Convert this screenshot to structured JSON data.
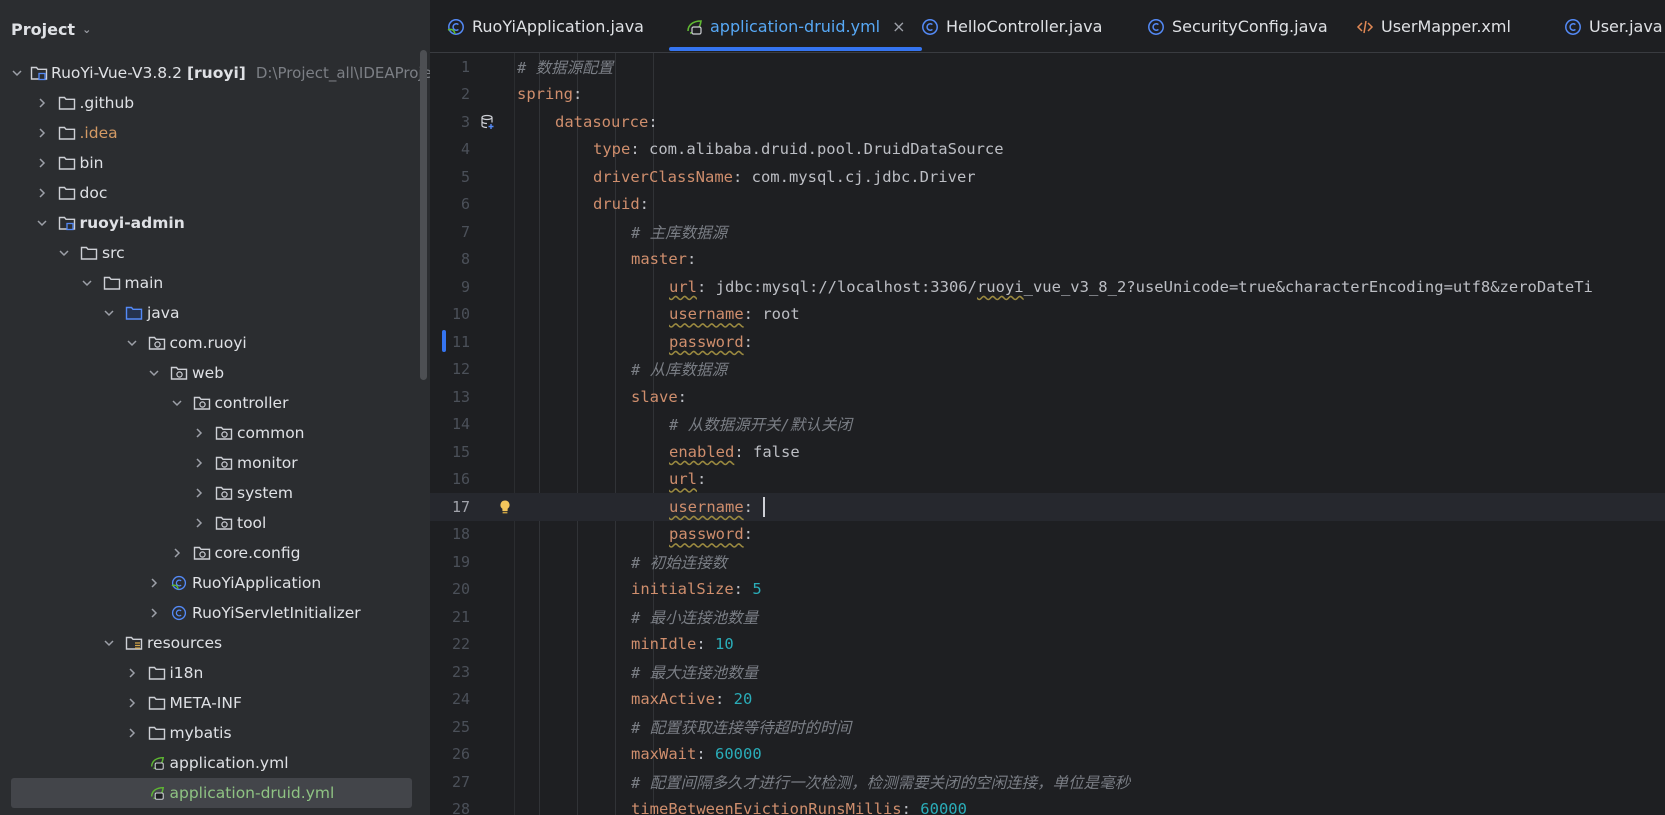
{
  "project_panel": {
    "title": "Project",
    "tree": [
      {
        "label": "RuoYi-Vue-V3.8.2",
        "suffix": "[ruoyi]",
        "path": "D:\\Project_all\\IDEAProjec",
        "depth": 0,
        "expanded": true,
        "icon": "module-folder-icon"
      },
      {
        "label": ".github",
        "depth": 1,
        "expanded": false,
        "icon": "folder-icon"
      },
      {
        "label": ".idea",
        "depth": 1,
        "expanded": false,
        "icon": "folder-icon",
        "style": "orange"
      },
      {
        "label": "bin",
        "depth": 1,
        "expanded": false,
        "icon": "folder-icon"
      },
      {
        "label": "doc",
        "depth": 1,
        "expanded": false,
        "icon": "folder-icon"
      },
      {
        "label": "ruoyi-admin",
        "depth": 1,
        "expanded": true,
        "icon": "module-folder-icon",
        "style": "bold"
      },
      {
        "label": "src",
        "depth": 2,
        "expanded": true,
        "icon": "folder-icon"
      },
      {
        "label": "main",
        "depth": 3,
        "expanded": true,
        "icon": "folder-icon"
      },
      {
        "label": "java",
        "depth": 4,
        "expanded": true,
        "icon": "source-folder-icon"
      },
      {
        "label": "com.ruoyi",
        "depth": 5,
        "expanded": true,
        "icon": "package-icon"
      },
      {
        "label": "web",
        "depth": 6,
        "expanded": true,
        "icon": "package-icon"
      },
      {
        "label": "controller",
        "depth": 7,
        "expanded": true,
        "icon": "package-icon"
      },
      {
        "label": "common",
        "depth": 8,
        "expanded": false,
        "icon": "package-icon"
      },
      {
        "label": "monitor",
        "depth": 8,
        "expanded": false,
        "icon": "package-icon"
      },
      {
        "label": "system",
        "depth": 8,
        "expanded": false,
        "icon": "package-icon"
      },
      {
        "label": "tool",
        "depth": 8,
        "expanded": false,
        "icon": "package-icon"
      },
      {
        "label": "core.config",
        "depth": 7,
        "expanded": false,
        "icon": "package-icon"
      },
      {
        "label": "RuoYiApplication",
        "depth": 6,
        "expanded": false,
        "icon": "spring-class-icon"
      },
      {
        "label": "RuoYiServletInitializer",
        "depth": 6,
        "expanded": false,
        "icon": "class-icon"
      },
      {
        "label": "resources",
        "depth": 4,
        "expanded": true,
        "icon": "resources-folder-icon"
      },
      {
        "label": "i18n",
        "depth": 5,
        "expanded": false,
        "icon": "folder-icon"
      },
      {
        "label": "META-INF",
        "depth": 5,
        "expanded": false,
        "icon": "folder-icon"
      },
      {
        "label": "mybatis",
        "depth": 5,
        "expanded": false,
        "icon": "folder-icon"
      },
      {
        "label": "application.yml",
        "depth": 5,
        "leaf": true,
        "icon": "spring-yaml-icon"
      },
      {
        "label": "application-druid.yml",
        "depth": 5,
        "leaf": true,
        "icon": "spring-yaml-icon",
        "selected": true,
        "style": "green"
      }
    ]
  },
  "tabs": [
    {
      "label": "RuoYiApplication.java",
      "icon": "spring-class-icon",
      "active": false
    },
    {
      "label": "application-druid.yml",
      "icon": "spring-yaml-icon",
      "active": true,
      "close": "×"
    },
    {
      "label": "HelloController.java",
      "icon": "class-icon",
      "active": false
    },
    {
      "label": "SecurityConfig.java",
      "icon": "class-icon",
      "active": false
    },
    {
      "label": "UserMapper.xml",
      "icon": "xml-icon",
      "active": false
    },
    {
      "label": "User.java",
      "icon": "class-icon",
      "active": false
    }
  ],
  "editor": {
    "current_line": 17,
    "lines": [
      {
        "n": "1",
        "indent": 0,
        "parts": [
          [
            "c",
            "# 数据源配置"
          ]
        ]
      },
      {
        "n": "2",
        "indent": 0,
        "parts": [
          [
            "k",
            "spring"
          ],
          [
            "s",
            ":"
          ]
        ]
      },
      {
        "n": "3",
        "indent": 1,
        "parts": [
          [
            "k",
            "datasource"
          ],
          [
            "s",
            ":"
          ]
        ]
      },
      {
        "n": "4",
        "indent": 2,
        "parts": [
          [
            "k",
            "type"
          ],
          [
            "s",
            ": com.alibaba.druid.pool.DruidDataSource"
          ]
        ]
      },
      {
        "n": "5",
        "indent": 2,
        "parts": [
          [
            "k",
            "driverClassName"
          ],
          [
            "s",
            ": com.mysql.cj.jdbc.Driver"
          ]
        ]
      },
      {
        "n": "6",
        "indent": 2,
        "parts": [
          [
            "k",
            "druid"
          ],
          [
            "s",
            ":"
          ]
        ]
      },
      {
        "n": "7",
        "indent": 3,
        "parts": [
          [
            "c",
            "# 主库数据源"
          ]
        ]
      },
      {
        "n": "8",
        "indent": 3,
        "parts": [
          [
            "k",
            "master"
          ],
          [
            "s",
            ":"
          ]
        ]
      },
      {
        "n": "9",
        "indent": 4,
        "parts": [
          [
            "ku",
            "url"
          ],
          [
            "s",
            ": jdbc:mysql://localhost:3306/"
          ],
          [
            "su",
            "ruoyi"
          ],
          [
            "s",
            "_vue_v3_8_2?useUnicode=true&characterEncoding=utf8&zeroDateTi"
          ]
        ]
      },
      {
        "n": "10",
        "indent": 4,
        "parts": [
          [
            "ku",
            "username"
          ],
          [
            "s",
            ": root"
          ]
        ]
      },
      {
        "n": "11",
        "indent": 4,
        "parts": [
          [
            "ku",
            "password"
          ],
          [
            "s",
            ":"
          ]
        ]
      },
      {
        "n": "12",
        "indent": 3,
        "parts": [
          [
            "c",
            "# 从库数据源"
          ]
        ]
      },
      {
        "n": "13",
        "indent": 3,
        "parts": [
          [
            "k",
            "slave"
          ],
          [
            "s",
            ":"
          ]
        ]
      },
      {
        "n": "14",
        "indent": 4,
        "parts": [
          [
            "c",
            "# 从数据源开关/默认关闭"
          ]
        ]
      },
      {
        "n": "15",
        "indent": 4,
        "parts": [
          [
            "ku",
            "enabled"
          ],
          [
            "s",
            ": false"
          ]
        ]
      },
      {
        "n": "16",
        "indent": 4,
        "parts": [
          [
            "ku",
            "url"
          ],
          [
            "s",
            ":"
          ]
        ]
      },
      {
        "n": "17",
        "indent": 4,
        "parts": [
          [
            "ku",
            "username"
          ],
          [
            "s",
            ": "
          ]
        ]
      },
      {
        "n": "18",
        "indent": 4,
        "parts": [
          [
            "ku",
            "password"
          ],
          [
            "s",
            ":"
          ]
        ]
      },
      {
        "n": "19",
        "indent": 3,
        "parts": [
          [
            "c",
            "# 初始连接数"
          ]
        ]
      },
      {
        "n": "20",
        "indent": 3,
        "parts": [
          [
            "k",
            "initialSize"
          ],
          [
            "s",
            ": "
          ],
          [
            "n",
            "5"
          ]
        ]
      },
      {
        "n": "21",
        "indent": 3,
        "parts": [
          [
            "c",
            "# 最小连接池数量"
          ]
        ]
      },
      {
        "n": "22",
        "indent": 3,
        "parts": [
          [
            "k",
            "minIdle"
          ],
          [
            "s",
            ": "
          ],
          [
            "n",
            "10"
          ]
        ]
      },
      {
        "n": "23",
        "indent": 3,
        "parts": [
          [
            "c",
            "# 最大连接池数量"
          ]
        ]
      },
      {
        "n": "24",
        "indent": 3,
        "parts": [
          [
            "k",
            "maxActive"
          ],
          [
            "s",
            ": "
          ],
          [
            "n",
            "20"
          ]
        ]
      },
      {
        "n": "25",
        "indent": 3,
        "parts": [
          [
            "c",
            "# 配置获取连接等待超时的时间"
          ]
        ]
      },
      {
        "n": "26",
        "indent": 3,
        "parts": [
          [
            "k",
            "maxWait"
          ],
          [
            "s",
            ": "
          ],
          [
            "n",
            "60000"
          ]
        ]
      },
      {
        "n": "27",
        "indent": 3,
        "parts": [
          [
            "c",
            "# 配置间隔多久才进行一次检测，检测需要关闭的空闲连接，单位是毫秒"
          ]
        ]
      },
      {
        "n": "28",
        "indent": 3,
        "parts": [
          [
            "k",
            "timeBetweenEvictionRunsMillis"
          ],
          [
            "s",
            ": "
          ],
          [
            "n",
            "60000"
          ]
        ]
      }
    ]
  },
  "colors": {
    "accent": "#3574f0",
    "keyword": "#cf8e6d",
    "comment": "#7a7e85",
    "number": "#2aacb8",
    "background": "#1e1f22",
    "panel": "#2b2d30"
  }
}
